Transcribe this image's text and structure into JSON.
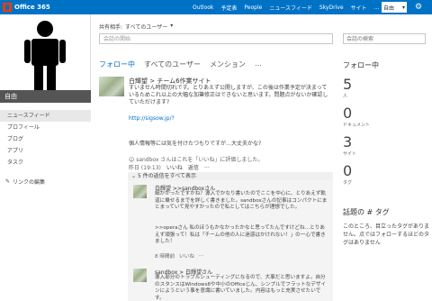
{
  "topbar": {
    "brand": "Office 365",
    "nav": [
      "Outlook",
      "予定表",
      "People",
      "ニュースフィード",
      "SkyDrive",
      "サイト",
      "…"
    ],
    "user": "自由",
    "colors": {
      "bar": "#0072c6",
      "logo": "#eb3c00"
    }
  },
  "profile": {
    "name": "自由"
  },
  "leftnav": {
    "items": [
      "ニュースフィード",
      "プロフィール",
      "ブログ",
      "アプリ",
      "タスク"
    ],
    "edit_links": "リンクの編集"
  },
  "share": {
    "label": "共有相手:",
    "target": "すべてのユーザー"
  },
  "post_box": {
    "placeholder": "会話の開始"
  },
  "tabs": [
    "フォロー中",
    "すべてのユーザー",
    "メンション",
    "…"
  ],
  "post1": {
    "author": "白輝望 > チーム6作業サイト",
    "body": "すいません時間切れです。とりあえず公開しますが、この後は作業予定が決まっているためこれ以上の大幅な加筆修正はできないと思います。問題点がないか確認していただけます?",
    "link": "http://sigsow.jp/?",
    "note": "個人情報等には気を付けたつもりですが…大丈夫かな?",
    "eval": "sandbox さんはこれを「いいね」に評価しました。",
    "time": "昨日 (19:13)",
    "actions": [
      "いいね",
      "返信",
      "…"
    ],
    "replies_bar": "5 件の返信をすべて表示"
  },
  "reply1": {
    "author": "白輝望  >>sandboxさん",
    "body": "細かかったですかね？導入でかなり書いたのでここを中心に、とりあえず軌道に乗せるまでを詳しく書きました。sandboxさんの記事はコンパクトにまとまっていて見やすかったので私としてはこちらが理想でした。",
    "body2": ">>operaさん 私のほうもかなかったかなと思ってたんですけどね…とりあえず頑張って！私は「チームの他の人に迷惑はかけれない！」の一心で書きました！",
    "time": "8 時間前",
    "actions": [
      "いいね",
      "…"
    ]
  },
  "reply2": {
    "author": "sandbox  > 白輝望さん",
    "body": "導入部分のトラブルシューティングになるので、大事だと思いますよ。自分のスタンスはWindows8や中小のOfficeじん、シンプルでフラットなデザインにようという事を意識に書いていました。内容はもっと充実させたいです。"
  },
  "search": {
    "placeholder": "会話の検索"
  },
  "follow": {
    "title": "フォロー中",
    "stats": [
      {
        "value": "5",
        "label": "人"
      },
      {
        "value": "0",
        "label": "ドキュメント"
      },
      {
        "value": "3",
        "label": "サイト"
      },
      {
        "value": "0",
        "label": "タグ"
      }
    ]
  },
  "tags": {
    "title": "話題の # タグ",
    "body": "このところ、目立ったタグがありません。点ではフォローするほどのタグはありません"
  }
}
